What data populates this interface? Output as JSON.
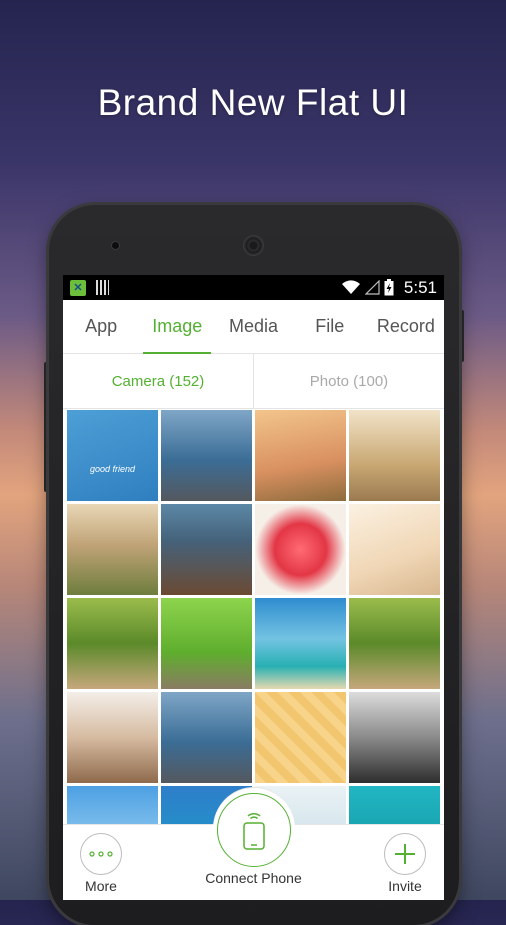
{
  "promo": {
    "title": "Brand New Flat UI"
  },
  "statusbar": {
    "time": "5:51"
  },
  "tabs": [
    {
      "label": "App",
      "active": false
    },
    {
      "label": "Image",
      "active": true
    },
    {
      "label": "Media",
      "active": false
    },
    {
      "label": "File",
      "active": false
    },
    {
      "label": "Record",
      "active": false
    }
  ],
  "subtabs": [
    {
      "label": "Camera (152)",
      "active": true
    },
    {
      "label": "Photo (100)",
      "active": false
    }
  ],
  "thumbnails": [
    {
      "name": "thumb-cartoon-friends",
      "caption": "good friend",
      "bg": "linear-gradient(160deg,#4d9fd6 0%,#2f7fc0 100%)"
    },
    {
      "name": "thumb-building-dock",
      "bg": "linear-gradient(180deg,#7fa6c6 0%,#3b6d96 55%,#54585e 100%)"
    },
    {
      "name": "thumb-girl-striped-shirt",
      "bg": "linear-gradient(170deg,#f2c58c 0%,#d99060 60%,#8d6b3c 100%)"
    },
    {
      "name": "thumb-girl-field",
      "bg": "linear-gradient(180deg,#f1e3c8 0%,#c9a873 60%,#9b7a51 100%)"
    },
    {
      "name": "thumb-girl-grass-sunset",
      "bg": "linear-gradient(180deg,#e9d7b6 0%,#c0a377 45%,#6e7d3d 100%)"
    },
    {
      "name": "thumb-man-portrait",
      "bg": "linear-gradient(180deg,#5c88a6 0%,#45627b 40%,#6b4a33 100%)"
    },
    {
      "name": "thumb-broken-heart",
      "bg": "radial-gradient(circle at 50% 50%,#ff6b74 0%,#e33645 40%,#f6efe8 70%)"
    },
    {
      "name": "thumb-sleeping-baby",
      "bg": "linear-gradient(160deg,#fbf1e1 0%,#f0d6b5 60%,#d7b78f 100%)"
    },
    {
      "name": "thumb-chipmunk",
      "bg": "linear-gradient(180deg,#9bbc4c 0%,#5b8a2a 50%,#c6a77c 100%)"
    },
    {
      "name": "thumb-owl-sunglasses",
      "bg": "linear-gradient(180deg,#8ed44d 0%,#5fae2e 60%,#8a7b63 100%)"
    },
    {
      "name": "thumb-boat-beach",
      "bg": "linear-gradient(180deg,#2f8ccf 0%,#73c3e2 45%,#28b0b3 75%,#e5d9b0 100%)"
    },
    {
      "name": "thumb-chipmunk-2",
      "bg": "linear-gradient(180deg,#9bbc4c 0%,#5b8a2a 50%,#c6a77c 100%)"
    },
    {
      "name": "thumb-woman-portrait",
      "bg": "linear-gradient(180deg,#f3eee8 0%,#d6bba1 50%,#8f6a4c 100%)"
    },
    {
      "name": "thumb-building-dock-2",
      "bg": "linear-gradient(180deg,#7fa6c6 0%,#3b6d96 55%,#54585e 100%)"
    },
    {
      "name": "thumb-cartoon-couple",
      "bg": "repeating-linear-gradient(45deg,#f8d38a 0 8px,#f2c66f 8px 16px)"
    },
    {
      "name": "thumb-man-bw",
      "bg": "linear-gradient(180deg,#dcdcdc 0%,#8a8a8a 50%,#2e2e2e 100%)"
    },
    {
      "name": "thumb-daisies-sky",
      "bg": "linear-gradient(180deg,#4da0e3 0%,#8bc6ee 60%,#ffffff 100%)"
    },
    {
      "name": "thumb-sea",
      "bg": "linear-gradient(180deg,#2e7ec9 0%,#1aa0c9 100%)"
    },
    {
      "name": "thumb-coast",
      "bg": "linear-gradient(180deg,#eaf2f5 0%,#bfd9e3 100%)"
    },
    {
      "name": "thumb-underwater",
      "bg": "linear-gradient(180deg,#22b7c3 0%,#0e8f9c 100%)"
    }
  ],
  "bottombar": {
    "more_label": "More",
    "connect_label": "Connect Phone",
    "invite_label": "Invite"
  },
  "colors": {
    "accent": "#54b032"
  }
}
